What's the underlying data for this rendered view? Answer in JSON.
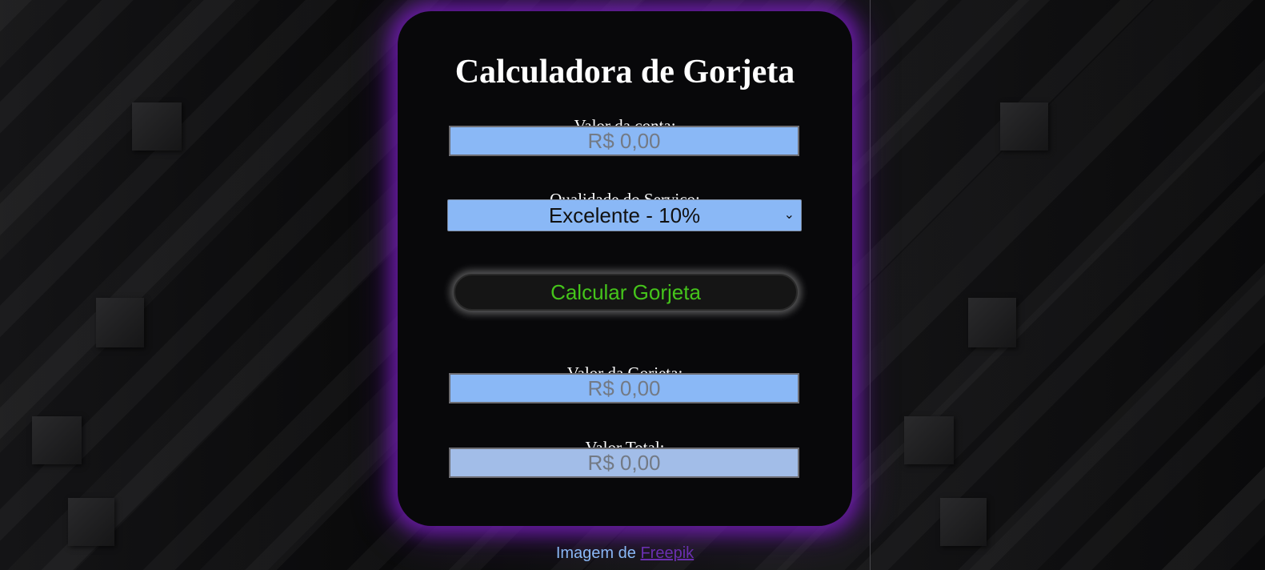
{
  "calculator": {
    "title": "Calculadora de Gorjeta",
    "bill": {
      "label": "Valor da conta:",
      "placeholder": "R$ 0,00"
    },
    "service": {
      "label": "Qualidade do Serviço:",
      "selected": "Excelente - 10%"
    },
    "calculate_button": "Calcular Gorjeta",
    "tip": {
      "label": "Valor da Gorjeta:",
      "placeholder": "R$ 0,00"
    },
    "total": {
      "label": "Valor Total:",
      "placeholder": "R$ 0,00"
    }
  },
  "footer": {
    "credit_prefix": "Imagem de",
    "credit_link": "Freepik"
  },
  "colors": {
    "field_background": "#8ab8f6",
    "button_text": "#45c41b",
    "card_glow": "#781ebe",
    "link": "#6a2fb0"
  },
  "icons": {
    "select_arrow": "chevron-down-icon"
  }
}
